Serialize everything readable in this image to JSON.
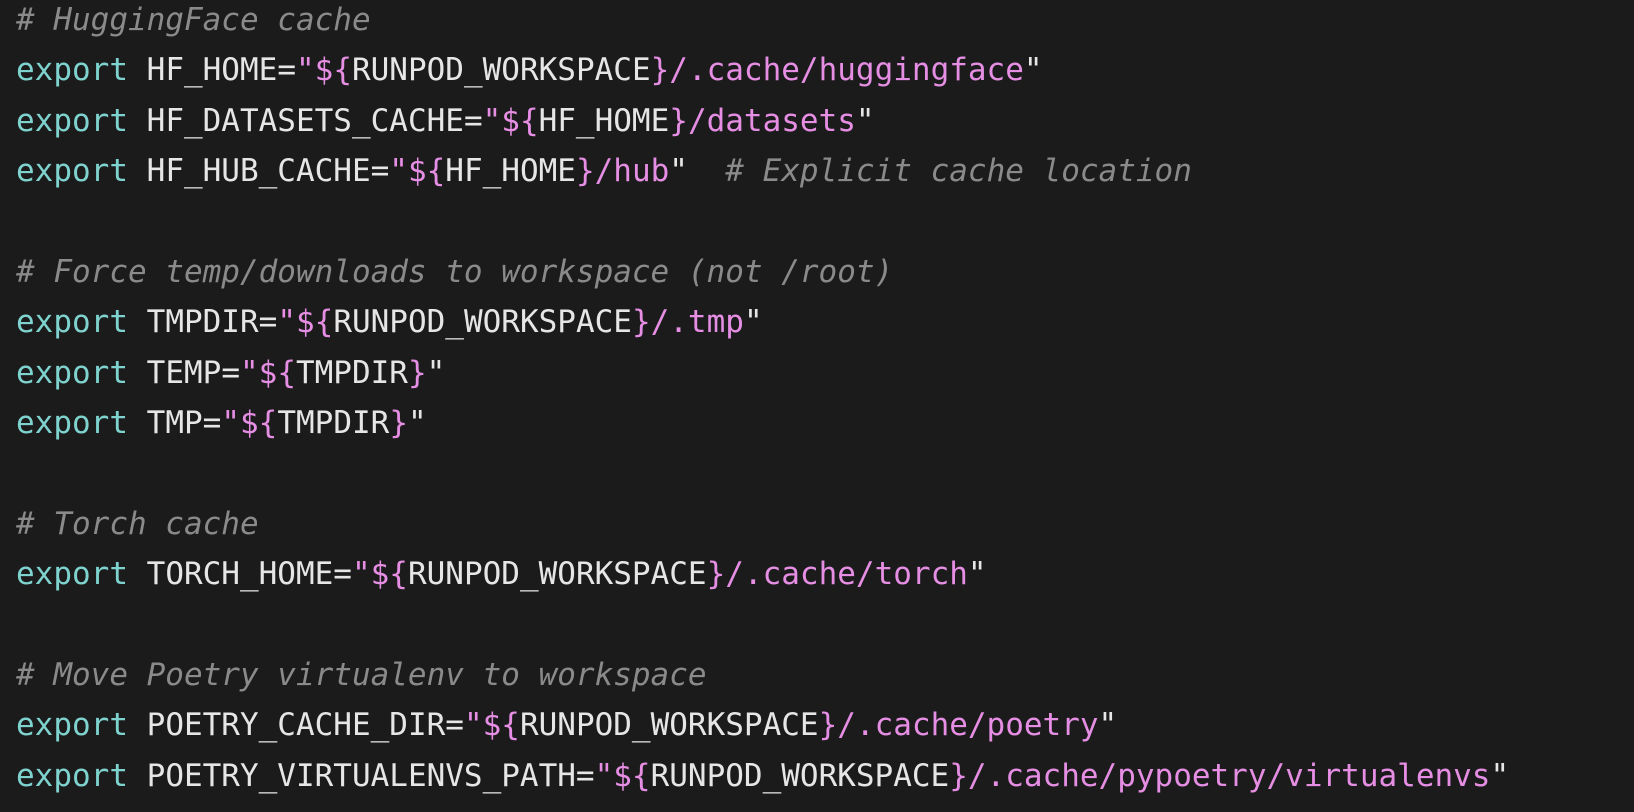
{
  "editor": {
    "lines": [
      {
        "type": "comment",
        "text": "# HuggingFace cache"
      },
      {
        "type": "export",
        "keyword": "export",
        "name": "HF_HOME",
        "eq": "=",
        "q1": "\"",
        "d1": "${",
        "v1": "RUNPOD_WORKSPACE",
        "d2": "}",
        "path": "/.cache/huggingface",
        "q2": "\"",
        "trailing": ""
      },
      {
        "type": "export",
        "keyword": "export",
        "name": "HF_DATASETS_CACHE",
        "eq": "=",
        "q1": "\"",
        "d1": "${",
        "v1": "HF_HOME",
        "d2": "}",
        "path": "/datasets",
        "q2": "\"",
        "trailing": ""
      },
      {
        "type": "export",
        "keyword": "export",
        "name": "HF_HUB_CACHE",
        "eq": "=",
        "q1": "\"",
        "d1": "${",
        "v1": "HF_HOME",
        "d2": "}",
        "path": "/hub",
        "q2": "\"",
        "trailing": "  # Explicit cache location"
      },
      {
        "type": "blank"
      },
      {
        "type": "comment",
        "text": "# Force temp/downloads to workspace (not /root)"
      },
      {
        "type": "export",
        "keyword": "export",
        "name": "TMPDIR",
        "eq": "=",
        "q1": "\"",
        "d1": "${",
        "v1": "RUNPOD_WORKSPACE",
        "d2": "}",
        "path": "/.tmp",
        "q2": "\"",
        "trailing": ""
      },
      {
        "type": "export",
        "keyword": "export",
        "name": "TEMP",
        "eq": "=",
        "q1": "\"",
        "d1": "${",
        "v1": "TMPDIR",
        "d2": "}",
        "path": "",
        "q2": "\"",
        "trailing": ""
      },
      {
        "type": "export",
        "keyword": "export",
        "name": "TMP",
        "eq": "=",
        "q1": "\"",
        "d1": "${",
        "v1": "TMPDIR",
        "d2": "}",
        "path": "",
        "q2": "\"",
        "trailing": ""
      },
      {
        "type": "blank"
      },
      {
        "type": "comment",
        "text": "# Torch cache"
      },
      {
        "type": "export",
        "keyword": "export",
        "name": "TORCH_HOME",
        "eq": "=",
        "q1": "\"",
        "d1": "${",
        "v1": "RUNPOD_WORKSPACE",
        "d2": "}",
        "path": "/.cache/torch",
        "q2": "\"",
        "trailing": ""
      },
      {
        "type": "blank"
      },
      {
        "type": "comment",
        "text": "# Move Poetry virtualenv to workspace"
      },
      {
        "type": "export",
        "keyword": "export",
        "name": "POETRY_CACHE_DIR",
        "eq": "=",
        "q1": "\"",
        "d1": "${",
        "v1": "RUNPOD_WORKSPACE",
        "d2": "}",
        "path": "/.cache/poetry",
        "q2": "\"",
        "trailing": ""
      },
      {
        "type": "export",
        "keyword": "export",
        "name": "POETRY_VIRTUALENVS_PATH",
        "eq": "=",
        "q1": "\"",
        "d1": "${",
        "v1": "RUNPOD_WORKSPACE",
        "d2": "}",
        "path": "/.cache/pypoetry/virtualenvs",
        "q2": "\"",
        "trailing": ""
      }
    ]
  },
  "theme": {
    "background": "#1b1b1b",
    "keyword": "#7fd3cf",
    "string": "#e58ee3",
    "comment": "#8a8a8a",
    "text": "#e6e6e6"
  }
}
